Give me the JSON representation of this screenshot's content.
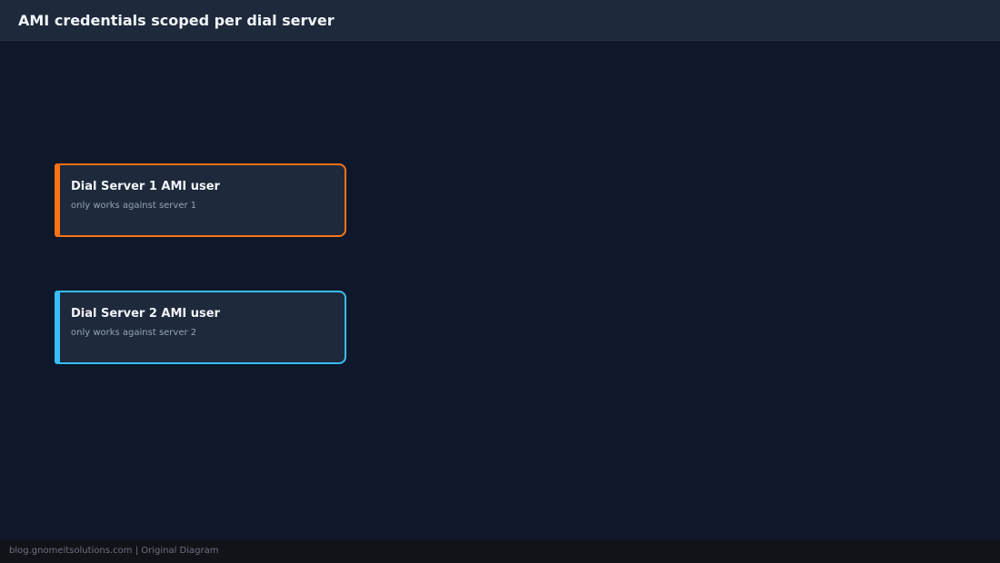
{
  "header": {
    "title": "AMI credentials scoped per dial server"
  },
  "cards": [
    {
      "title": "Dial Server 1 AMI user",
      "subtitle": "only works against server 1",
      "accent": "#f97316"
    },
    {
      "title": "Dial Server 2 AMI user",
      "subtitle": "only works against server 2",
      "accent": "#38bdf8"
    }
  ],
  "footer": {
    "text": "blog.gnomeitsolutions.com | Original Diagram"
  },
  "colors": {
    "background": "#0f172a",
    "header_bg": "#1e293b",
    "card_bg": "#1e293b",
    "footer_bg": "#111318"
  }
}
